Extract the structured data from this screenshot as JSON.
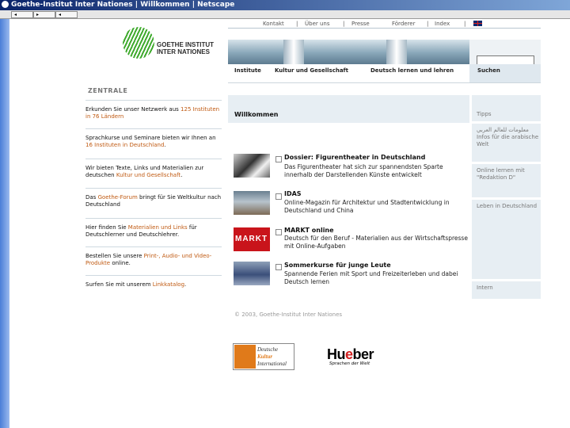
{
  "browser": {
    "title": "Goethe-Institut Inter Nationes | Willkommen | Netscape",
    "back_label": "◂",
    "forward_label": "▸",
    "reload_label": "◂"
  },
  "top_links": [
    "Kontakt",
    "|",
    "Über uns",
    "|",
    "Presse",
    "Förderer",
    "|",
    "Index",
    "|"
  ],
  "logo": {
    "line1": "GOETHE INSTITUT",
    "line2": "INTER NATIONES"
  },
  "main_nav": [
    "Institute",
    "Kultur und Gesellschaft",
    "Deutsch lernen und lehren"
  ],
  "search_label": "Suchen",
  "sidebar_title": "ZENTRALE",
  "left_items": [
    {
      "pre": "Erkunden Sie unser Netzwerk aus ",
      "hl": "125 Instituten in 76 Ländern",
      "post": ""
    },
    {
      "pre": "Sprachkurse und Seminare bieten wir Ihnen an ",
      "hl": "16 Instituten in Deutschland",
      "post": "."
    },
    {
      "pre": "Wir bieten Texte, Links und Materialien zur deutschen ",
      "hl": "Kultur und Gesellschaft",
      "post": "."
    },
    {
      "pre": "Das ",
      "hl": "Goethe-Forum",
      "post": " bringt für Sie Weltkultur nach Deutschland"
    },
    {
      "pre": "Hier finden Sie ",
      "hl": "Materialien und Links",
      "post": " für Deutschlerner und Deutschlehrer."
    },
    {
      "pre": "Bestellen Sie unsere ",
      "hl": "Print-, Audio- und Video-Produkte",
      "post": " online."
    },
    {
      "pre": "Surfen Sie mit unserem ",
      "hl": "Linkkatalog",
      "post": "."
    }
  ],
  "welcome": "Willkommen",
  "news": [
    {
      "title": "Dossier: Figurentheater in Deutschland",
      "body": "Das Figurentheater hat sich zur spannendsten Sparte innerhalb der Darstellenden Künste entwickelt"
    },
    {
      "title": "IDAS",
      "body": "Online-Magazin für Architektur und Stadtentwicklung in Deutschland und China"
    },
    {
      "title": "MARKT online",
      "body": "Deutsch für den Beruf - Materialien aus der Wirtschaftspresse mit Online-Aufgaben",
      "thumb_label": "MARKT"
    },
    {
      "title": "Sommerkurse für junge Leute",
      "body": "Spannende Ferien mit Sport und Freizeiterleben und dabei Deutsch lernen"
    }
  ],
  "right_items": [
    {
      "text": "Tipps"
    },
    {
      "text": "معلومات للعالم العربي Infos für die arabische Welt"
    },
    {
      "text": "Online lernen mit \"Redaktion D\""
    },
    {
      "text": "Leben in Deutschland"
    },
    {
      "text": "Intern"
    }
  ],
  "copyright": "© 2003, Goethe-Institut Inter Nationes",
  "partners": {
    "dki_lines": [
      "Deutsche",
      "Kultur",
      "International"
    ],
    "hueber_main_a": "Hu",
    "hueber_main_e": "e",
    "hueber_main_b": "ber",
    "hueber_sub": "Sprachen der Welt"
  },
  "colors": {
    "accent": "#c05a12",
    "logo_green": "#3faa2d",
    "panel": "#e7eef3"
  }
}
